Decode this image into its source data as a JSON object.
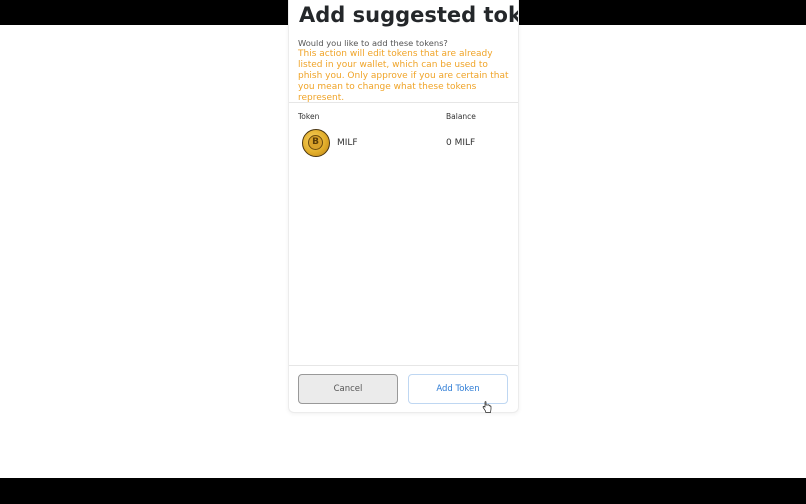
{
  "dialog": {
    "title": "Add suggested tokens",
    "question": "Would you like to add these tokens?",
    "warning": "This action will edit tokens that are already listed in your wallet, which can be used to phish you. Only approve if you are certain that you mean to change what these tokens represent.",
    "warning_color": "#f0a428"
  },
  "table": {
    "headers": {
      "token": "Token",
      "balance": "Balance"
    },
    "rows": [
      {
        "symbol": "MILF",
        "balance": "0 MILF",
        "icon": "token-coin-icon"
      }
    ]
  },
  "buttons": {
    "cancel": "Cancel",
    "add_token": "Add Token",
    "add_token_color": "#2f7dd6"
  }
}
